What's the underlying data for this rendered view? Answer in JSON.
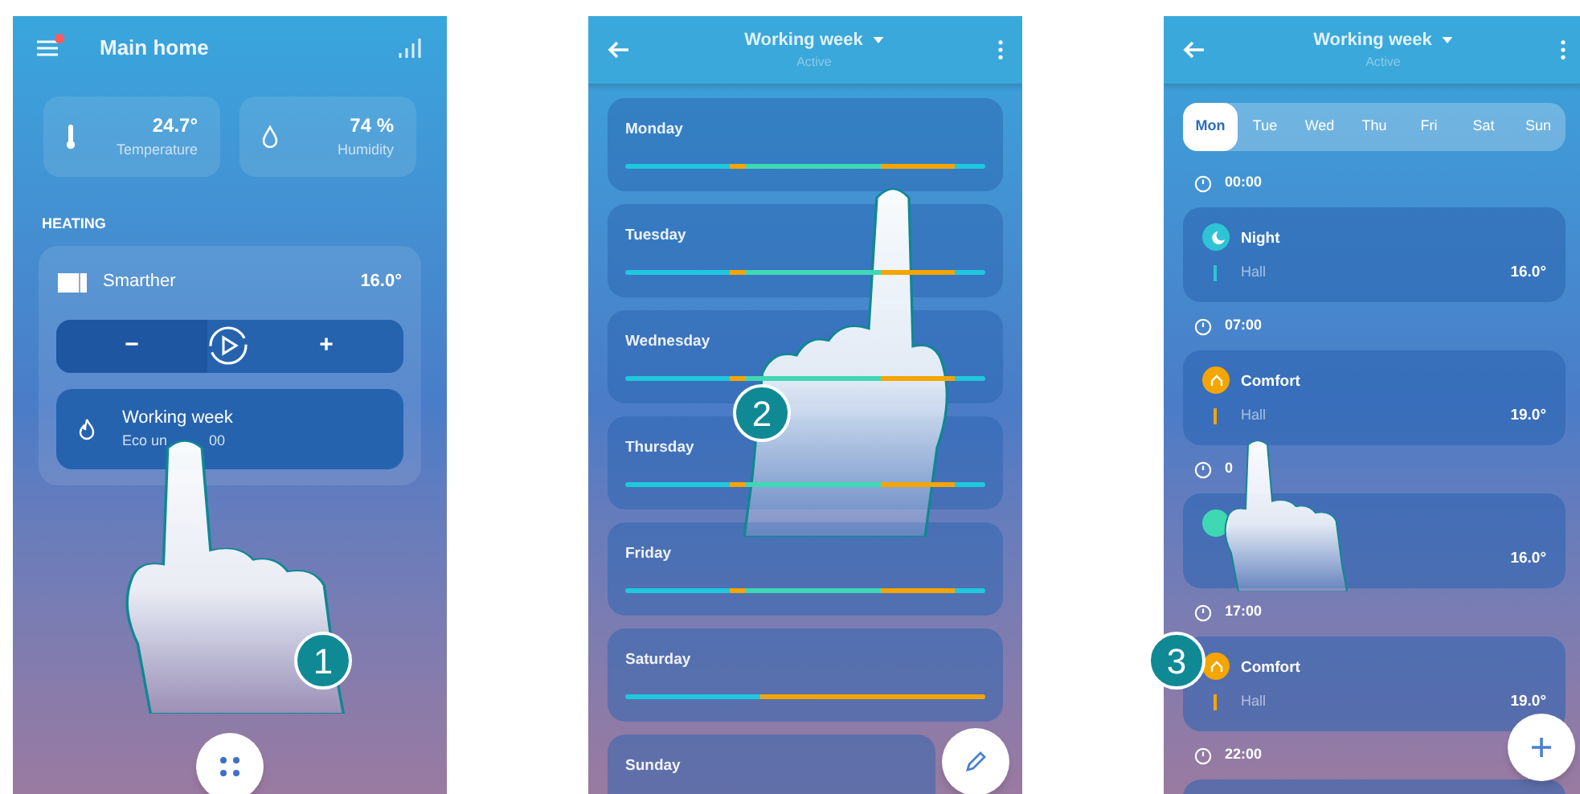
{
  "screens": [
    {
      "kind": "home",
      "header": {
        "title": "Main home",
        "notification": true
      },
      "sensors": [
        {
          "kind": "temperature",
          "value": "24.7°",
          "label": "Temperature"
        },
        {
          "kind": "humidity",
          "value": "74 %",
          "label": "Humidity"
        }
      ],
      "section_title": "HEATING",
      "thermostat": {
        "name": "Smarther",
        "temperature": "16.0°",
        "minus": "−",
        "plus": "+"
      },
      "program": {
        "title": "Working week",
        "subtitle_parts": [
          "Eco un",
          "00"
        ]
      },
      "step": "1"
    },
    {
      "kind": "week",
      "header": {
        "title": "Working week",
        "subtitle": "Active"
      },
      "days": [
        {
          "name": "Monday",
          "hours": [
            {
              "color": "#1fc8de"
            },
            {
              "color": "#1fc8de"
            },
            {
              "color": "#1fc8de"
            },
            {
              "color": "#1fc8de"
            },
            {
              "color": "#1fc8de"
            },
            {
              "color": "#1fc8de"
            },
            {
              "color": "#1fc8de"
            },
            {
              "color": "#f5a500"
            },
            {
              "color": "#3fd8b4"
            },
            {
              "color": "#3fd8b4"
            },
            {
              "color": "#3fd8b4"
            },
            {
              "color": "#3fd8b4"
            },
            {
              "color": "#3fd8b4"
            },
            {
              "color": "#3fd8b4"
            },
            {
              "color": "#3fd8b4"
            },
            {
              "color": "#3fd8b4"
            },
            {
              "color": "#3fd8b4"
            },
            {
              "color": "#f5a500"
            },
            {
              "color": "#f5a500"
            },
            {
              "color": "#f5a500"
            },
            {
              "color": "#f5a500"
            },
            {
              "color": "#f5a500"
            },
            {
              "color": "#1fc8de"
            },
            {
              "color": "#1fc8de"
            }
          ]
        },
        {
          "name": "Tuesday",
          "hours": [
            {
              "color": "#1fc8de"
            },
            {
              "color": "#1fc8de"
            },
            {
              "color": "#1fc8de"
            },
            {
              "color": "#1fc8de"
            },
            {
              "color": "#1fc8de"
            },
            {
              "color": "#1fc8de"
            },
            {
              "color": "#1fc8de"
            },
            {
              "color": "#f5a500"
            },
            {
              "color": "#3fd8b4"
            },
            {
              "color": "#3fd8b4"
            },
            {
              "color": "#3fd8b4"
            },
            {
              "color": "#3fd8b4"
            },
            {
              "color": "#3fd8b4"
            },
            {
              "color": "#3fd8b4"
            },
            {
              "color": "#3fd8b4"
            },
            {
              "color": "#3fd8b4"
            },
            {
              "color": "#3fd8b4"
            },
            {
              "color": "#f5a500"
            },
            {
              "color": "#f5a500"
            },
            {
              "color": "#f5a500"
            },
            {
              "color": "#f5a500"
            },
            {
              "color": "#f5a500"
            },
            {
              "color": "#1fc8de"
            },
            {
              "color": "#1fc8de"
            }
          ]
        },
        {
          "name": "Wednesday",
          "hours": [
            {
              "color": "#1fc8de"
            },
            {
              "color": "#1fc8de"
            },
            {
              "color": "#1fc8de"
            },
            {
              "color": "#1fc8de"
            },
            {
              "color": "#1fc8de"
            },
            {
              "color": "#1fc8de"
            },
            {
              "color": "#1fc8de"
            },
            {
              "color": "#f5a500"
            },
            {
              "color": "#3fd8b4"
            },
            {
              "color": "#3fd8b4"
            },
            {
              "color": "#3fd8b4"
            },
            {
              "color": "#3fd8b4"
            },
            {
              "color": "#3fd8b4"
            },
            {
              "color": "#3fd8b4"
            },
            {
              "color": "#3fd8b4"
            },
            {
              "color": "#3fd8b4"
            },
            {
              "color": "#3fd8b4"
            },
            {
              "color": "#f5a500"
            },
            {
              "color": "#f5a500"
            },
            {
              "color": "#f5a500"
            },
            {
              "color": "#f5a500"
            },
            {
              "color": "#f5a500"
            },
            {
              "color": "#1fc8de"
            },
            {
              "color": "#1fc8de"
            }
          ]
        },
        {
          "name": "Thursday",
          "hours": [
            {
              "color": "#1fc8de"
            },
            {
              "color": "#1fc8de"
            },
            {
              "color": "#1fc8de"
            },
            {
              "color": "#1fc8de"
            },
            {
              "color": "#1fc8de"
            },
            {
              "color": "#1fc8de"
            },
            {
              "color": "#1fc8de"
            },
            {
              "color": "#f5a500"
            },
            {
              "color": "#3fd8b4"
            },
            {
              "color": "#3fd8b4"
            },
            {
              "color": "#3fd8b4"
            },
            {
              "color": "#3fd8b4"
            },
            {
              "color": "#3fd8b4"
            },
            {
              "color": "#3fd8b4"
            },
            {
              "color": "#3fd8b4"
            },
            {
              "color": "#3fd8b4"
            },
            {
              "color": "#3fd8b4"
            },
            {
              "color": "#f5a500"
            },
            {
              "color": "#f5a500"
            },
            {
              "color": "#f5a500"
            },
            {
              "color": "#f5a500"
            },
            {
              "color": "#f5a500"
            },
            {
              "color": "#1fc8de"
            },
            {
              "color": "#1fc8de"
            }
          ]
        },
        {
          "name": "Friday",
          "hours": [
            {
              "color": "#1fc8de"
            },
            {
              "color": "#1fc8de"
            },
            {
              "color": "#1fc8de"
            },
            {
              "color": "#1fc8de"
            },
            {
              "color": "#1fc8de"
            },
            {
              "color": "#1fc8de"
            },
            {
              "color": "#1fc8de"
            },
            {
              "color": "#f5a500"
            },
            {
              "color": "#3fd8b4"
            },
            {
              "color": "#3fd8b4"
            },
            {
              "color": "#3fd8b4"
            },
            {
              "color": "#3fd8b4"
            },
            {
              "color": "#3fd8b4"
            },
            {
              "color": "#3fd8b4"
            },
            {
              "color": "#3fd8b4"
            },
            {
              "color": "#3fd8b4"
            },
            {
              "color": "#3fd8b4"
            },
            {
              "color": "#f5a500"
            },
            {
              "color": "#f5a500"
            },
            {
              "color": "#f5a500"
            },
            {
              "color": "#f5a500"
            },
            {
              "color": "#f5a500"
            },
            {
              "color": "#1fc8de"
            },
            {
              "color": "#1fc8de"
            }
          ]
        },
        {
          "name": "Saturday",
          "hours": [
            {
              "color": "#1fc8de"
            },
            {
              "color": "#1fc8de"
            },
            {
              "color": "#1fc8de"
            },
            {
              "color": "#1fc8de"
            },
            {
              "color": "#1fc8de"
            },
            {
              "color": "#1fc8de"
            },
            {
              "color": "#1fc8de"
            },
            {
              "color": "#1fc8de"
            },
            {
              "color": "#1fc8de"
            },
            {
              "color": "#f5a500"
            },
            {
              "color": "#f5a500"
            },
            {
              "color": "#f5a500"
            },
            {
              "color": "#f5a500"
            },
            {
              "color": "#f5a500"
            },
            {
              "color": "#f5a500"
            },
            {
              "color": "#f5a500"
            },
            {
              "color": "#f5a500"
            },
            {
              "color": "#f5a500"
            },
            {
              "color": "#f5a500"
            },
            {
              "color": "#f5a500"
            },
            {
              "color": "#f5a500"
            },
            {
              "color": "#f5a500"
            },
            {
              "color": "#f5a500"
            },
            {
              "color": "#f5a500"
            }
          ]
        },
        {
          "name": "Sunday"
        }
      ],
      "step": "2"
    },
    {
      "kind": "day",
      "header": {
        "title": "Working week",
        "subtitle": "Active"
      },
      "tabs": [
        {
          "label": "Mon",
          "selected": true
        },
        {
          "label": "Tue",
          "selected": false
        },
        {
          "label": "Wed",
          "selected": false
        },
        {
          "label": "Thu",
          "selected": false
        },
        {
          "label": "Fri",
          "selected": false
        },
        {
          "label": "Sat",
          "selected": false
        },
        {
          "label": "Sun",
          "selected": false
        }
      ],
      "slots": [
        {
          "time": "00:00",
          "kind": "night",
          "mode": "Night",
          "color": "#2fc3d6",
          "zone": "Hall",
          "temperature": "16.0°"
        },
        {
          "time": "07:00",
          "kind": "comfort",
          "mode": "Comfort",
          "color": "#f5a500",
          "zone": "Hall",
          "temperature": "19.0°"
        },
        {
          "time": "0",
          "color": "#3fd8b4",
          "temperature": "16.0°"
        },
        {
          "time": "17:00",
          "kind": "comfort",
          "mode": "Comfort",
          "color": "#f5a500",
          "zone": "Hall",
          "temperature": "19.0°"
        },
        {
          "time": "22:00"
        }
      ],
      "step": "3"
    }
  ]
}
